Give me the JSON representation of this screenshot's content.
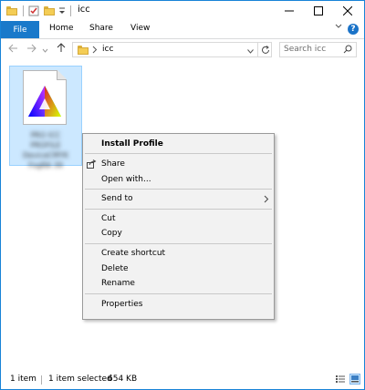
{
  "window": {
    "title": "icc"
  },
  "ribbon": {
    "tabs": [
      "File",
      "Home",
      "Share",
      "View"
    ]
  },
  "address": {
    "path_item": "icc",
    "search_placeholder": "Search icc"
  },
  "file": {
    "name_blurred": "PRO ICC PROFILE DeviceCMYK FogRA 39"
  },
  "context_menu": {
    "items": [
      "Install Profile",
      "Share",
      "Open with...",
      "Send to",
      "Cut",
      "Copy",
      "Create shortcut",
      "Delete",
      "Rename",
      "Properties"
    ]
  },
  "status": {
    "count": "1 item",
    "selected": "1 item selected",
    "size": "654 KB"
  },
  "colors": {
    "accent": "#1979ca",
    "selection": "#cce8ff",
    "folder": "#f4cd55",
    "menu_bg": "#f2f2f2"
  }
}
